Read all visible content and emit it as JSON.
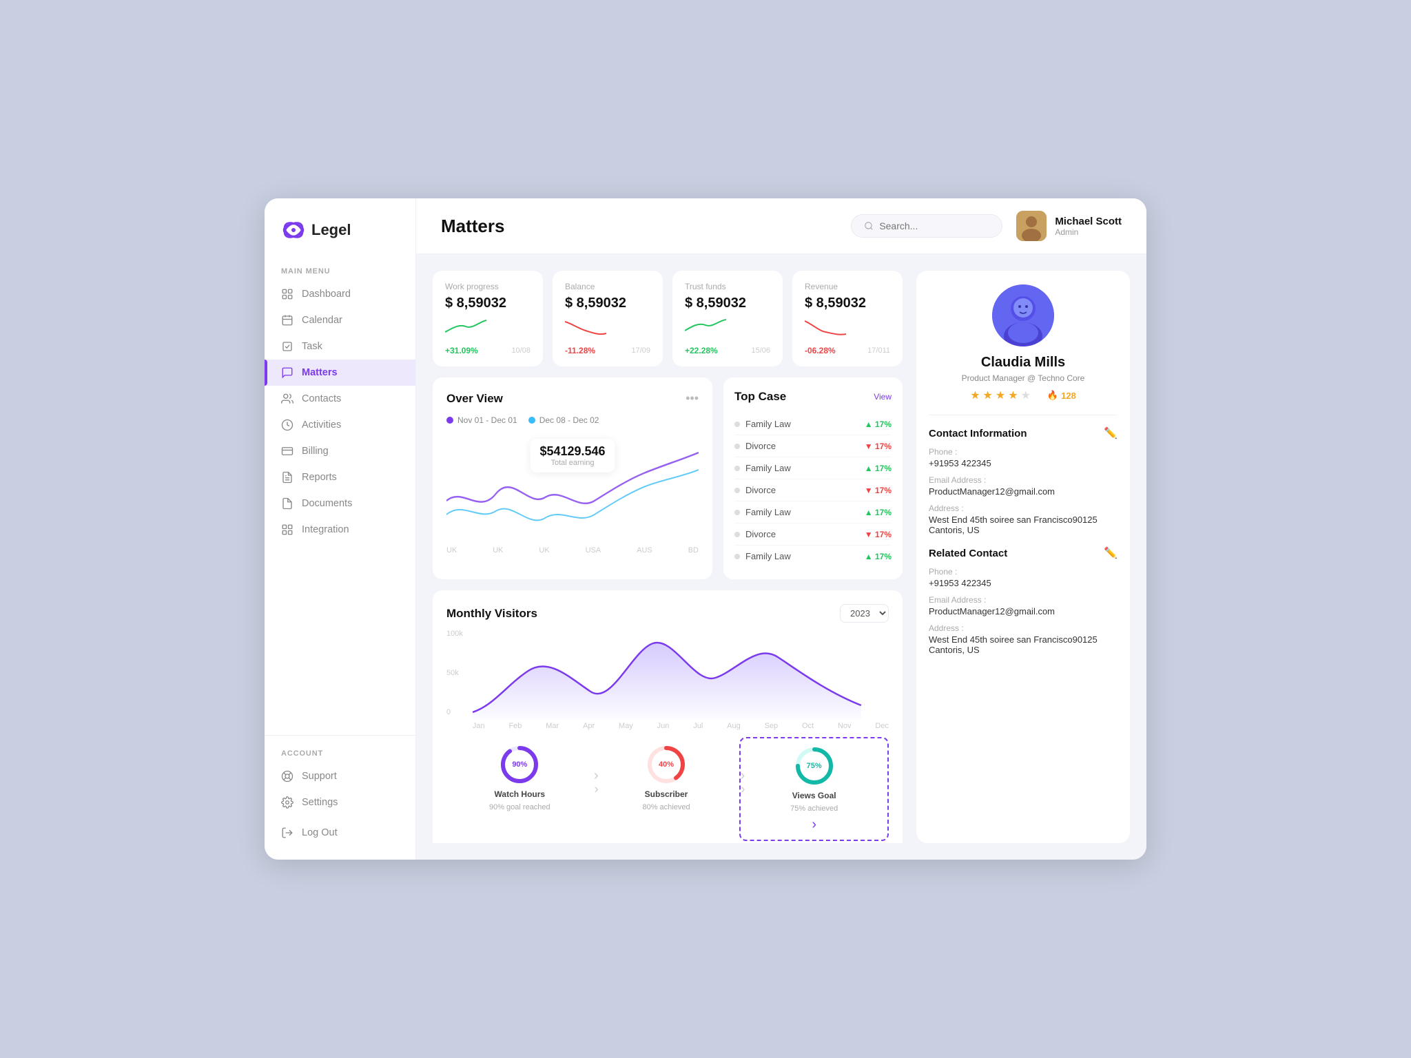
{
  "app": {
    "name": "Legel"
  },
  "header": {
    "page_title": "Matters",
    "search_placeholder": "Search...",
    "user": {
      "name": "Michael Scott",
      "role": "Admin"
    }
  },
  "sidebar": {
    "main_menu_label": "MAIN MENU",
    "account_label": "ACCOUNT",
    "nav_items": [
      {
        "id": "dashboard",
        "label": "Dashboard"
      },
      {
        "id": "calendar",
        "label": "Calendar"
      },
      {
        "id": "task",
        "label": "Task"
      },
      {
        "id": "matters",
        "label": "Matters",
        "active": true
      },
      {
        "id": "contacts",
        "label": "Contacts"
      },
      {
        "id": "activities",
        "label": "Activities"
      },
      {
        "id": "billing",
        "label": "Billing"
      },
      {
        "id": "reports",
        "label": "Reports"
      },
      {
        "id": "documents",
        "label": "Documents"
      },
      {
        "id": "integration",
        "label": "Integration"
      }
    ],
    "account_items": [
      {
        "id": "support",
        "label": "Support"
      },
      {
        "id": "settings",
        "label": "Settings"
      }
    ],
    "logout_label": "Log Out"
  },
  "stat_cards": [
    {
      "label": "Work progress",
      "value": "$ 8,59032",
      "change": "+31.09%",
      "change_dir": "up",
      "date": "10/08"
    },
    {
      "label": "Balance",
      "value": "$ 8,59032",
      "change": "-11.28%",
      "change_dir": "down",
      "date": "17/09"
    },
    {
      "label": "Trust funds",
      "value": "$ 8,59032",
      "change": "+22.28%",
      "change_dir": "up",
      "date": "15/06"
    },
    {
      "label": "Revenue",
      "value": "$ 8,59032",
      "change": "-06.28%",
      "change_dir": "down",
      "date": "17/011"
    }
  ],
  "overview": {
    "title": "Over View",
    "legend": [
      {
        "label": "Nov 01 - Dec 01",
        "color": "#7c3aed"
      },
      {
        "label": "Dec 08 - Dec 02",
        "color": "#38bdf8"
      }
    ],
    "total_earning": "$54129.546",
    "total_earning_label": "Total earning",
    "xaxis": [
      "UK",
      "UK",
      "UK",
      "USA",
      "AUS",
      "BD"
    ]
  },
  "top_case": {
    "title": "Top Case",
    "view_label": "View",
    "items": [
      {
        "name": "Family Law",
        "pct": "17%",
        "dir": "up"
      },
      {
        "name": "Divorce",
        "pct": "17%",
        "dir": "down"
      },
      {
        "name": "Family Law",
        "pct": "17%",
        "dir": "up"
      },
      {
        "name": "Divorce",
        "pct": "17%",
        "dir": "down"
      },
      {
        "name": "Family Law",
        "pct": "17%",
        "dir": "up"
      },
      {
        "name": "Divorce",
        "pct": "17%",
        "dir": "down"
      },
      {
        "name": "Family Law",
        "pct": "17%",
        "dir": "up"
      }
    ]
  },
  "monthly_visitors": {
    "title": "Monthly Visitors",
    "year": "2023",
    "yaxis": [
      "100k",
      "50k",
      "0"
    ],
    "xaxis": [
      "Jan",
      "Feb",
      "Mar",
      "Apr",
      "May",
      "Jun",
      "Jul",
      "Aug",
      "Sep",
      "Oct",
      "Nov",
      "Dec"
    ]
  },
  "mini_stats": [
    {
      "label": "Watch Hours",
      "sub": "90% goal reached",
      "pct": 90,
      "color": "#7c3aed",
      "bg": "#ede8fc"
    },
    {
      "label": "Subscriber",
      "sub": "80% achieved",
      "pct": 40,
      "color": "#ef4444",
      "bg": "#fee2e2"
    },
    {
      "label": "Views Goal",
      "sub": "75% achieved",
      "pct": 75,
      "color": "#14b8a6",
      "bg": "#d1faf5"
    }
  ],
  "profile": {
    "name": "Claudia Mills",
    "role": "Product Manager @ Techno Core",
    "stars": 4,
    "fire_count": 128
  },
  "contact_info": {
    "title": "Contact Information",
    "phone_label": "Phone :",
    "phone": "+91953 422345",
    "email_label": "Email Address :",
    "email": "ProductManager12@gmail.com",
    "address_label": "Address :",
    "address": "West End 45th soiree san Francisco90125 Cantoris, US"
  },
  "related_contact": {
    "title": "Related Contact",
    "phone_label": "Phone :",
    "phone": "+91953 422345",
    "email_label": "Email Address :",
    "email": "ProductManager12@gmail.com",
    "address_label": "Address :",
    "address": "West End 45th soiree san Francisco90125 Cantoris, US"
  }
}
